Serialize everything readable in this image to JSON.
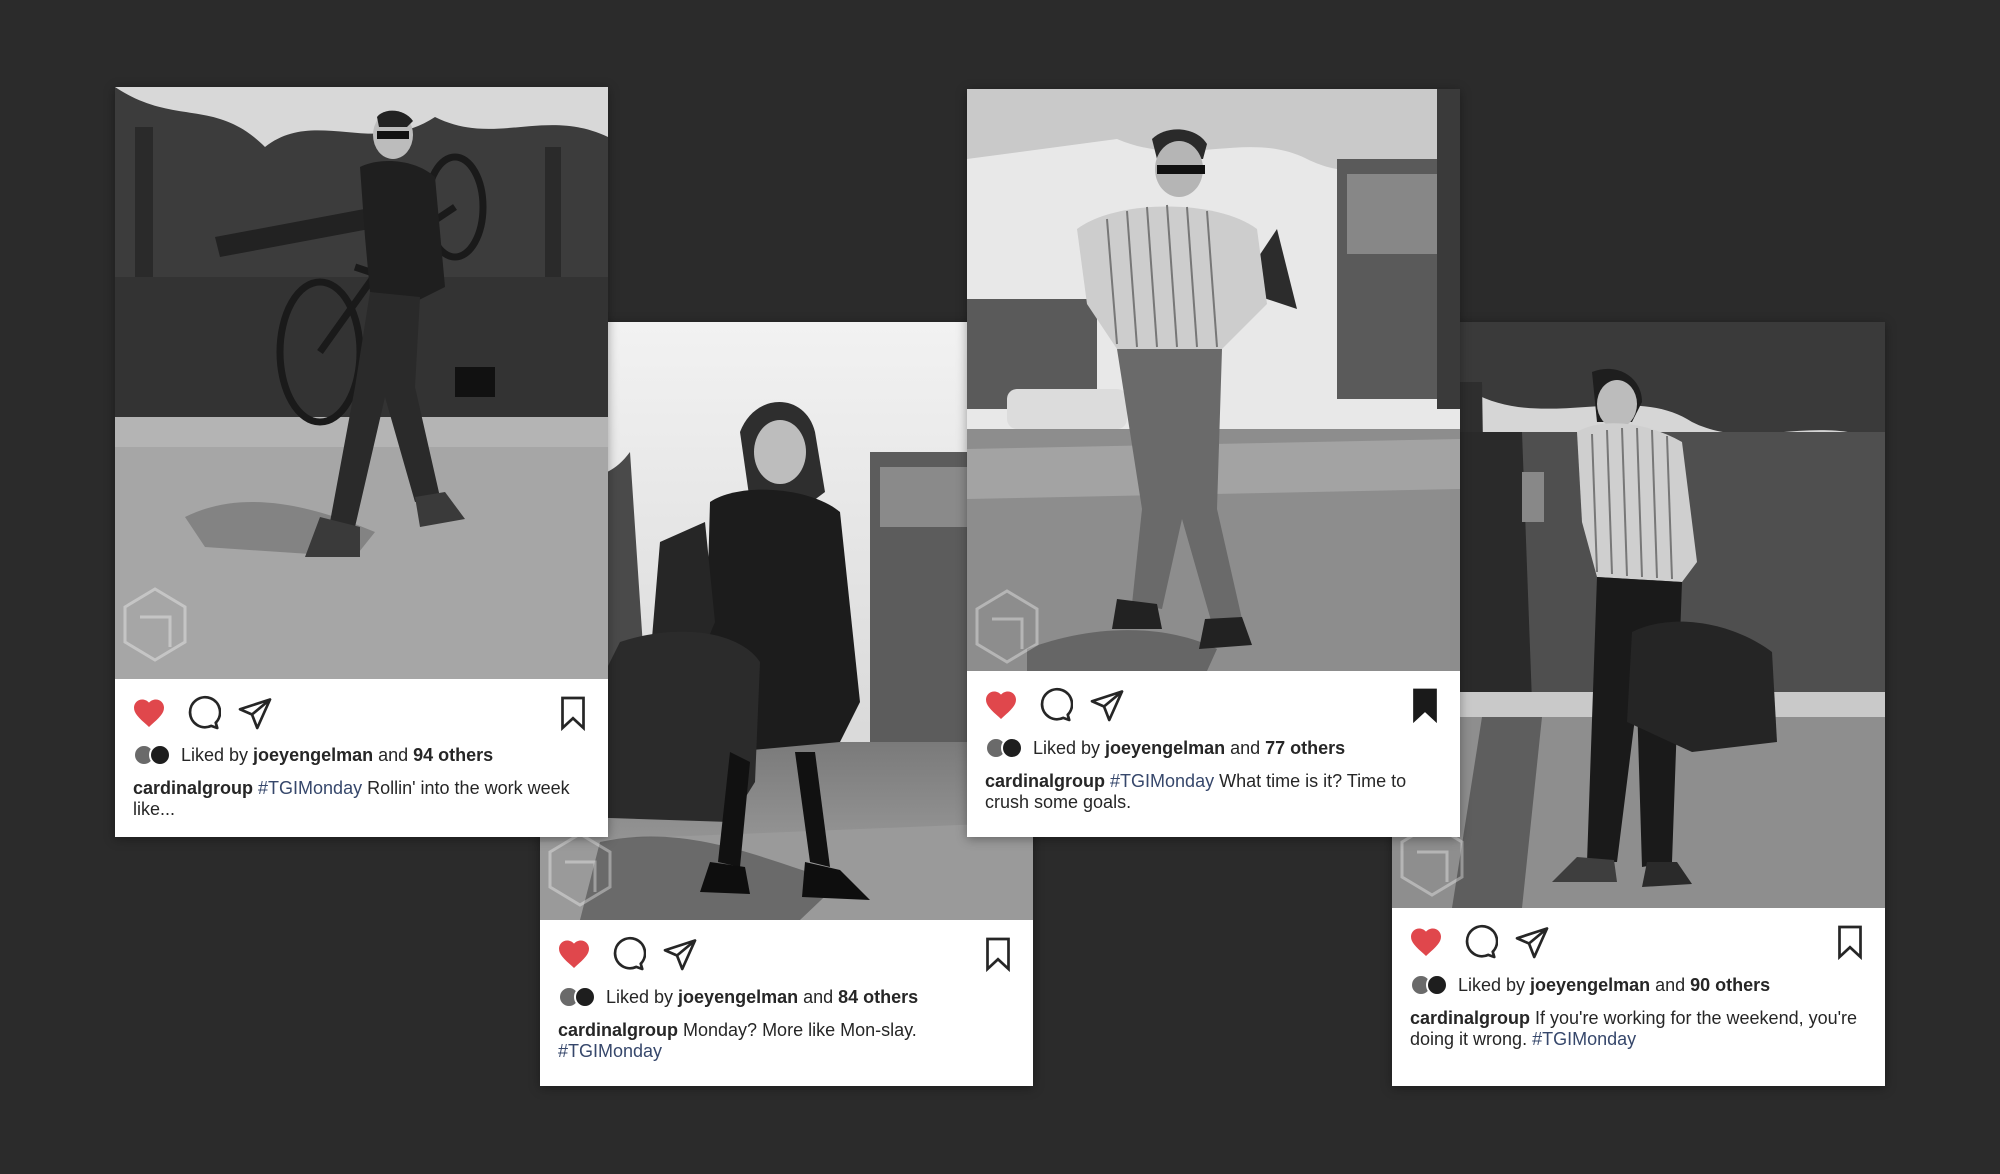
{
  "posts": [
    {
      "id": "post-1",
      "liked_by": "joeyengelman",
      "likes_prefix": "Liked by",
      "likes_and": "and",
      "likes_count": "94 others",
      "username": "cardinalgroup",
      "caption_pre": "",
      "hashtag_mid": "#TGIMonday",
      "caption_post": " Rollin' into the work week like...",
      "bookmarked": false
    },
    {
      "id": "post-2",
      "liked_by": "joeyengelman",
      "likes_prefix": "Liked by",
      "likes_and": "and",
      "likes_count": "84 others",
      "username": "cardinalgroup",
      "caption_pre": " Monday? More like Mon-slay.",
      "hashtag_end": "#TGIMonday",
      "bookmarked": false
    },
    {
      "id": "post-3",
      "liked_by": "joeyengelman",
      "likes_prefix": "Liked by",
      "likes_and": "and",
      "likes_count": "77 others",
      "username": "cardinalgroup",
      "caption_pre": "",
      "hashtag_mid": "#TGIMonday",
      "caption_post": " What time is it? Time to crush some goals.",
      "bookmarked": true
    },
    {
      "id": "post-4",
      "liked_by": "joeyengelman",
      "likes_prefix": "Liked by",
      "likes_and": "and",
      "likes_count": "90 others",
      "username": "cardinalgroup",
      "caption_pre": " If you're working for the weekend, you're doing it wrong.",
      "hashtag_end": "#TGIMonday",
      "bookmarked": false
    }
  ],
  "colors": {
    "background": "#2b2b2b",
    "heart": "#e0474c",
    "hashtag": "#36476b",
    "card": "#ffffff"
  },
  "icons": [
    "heart-icon",
    "comment-icon",
    "share-icon",
    "bookmark-icon"
  ]
}
